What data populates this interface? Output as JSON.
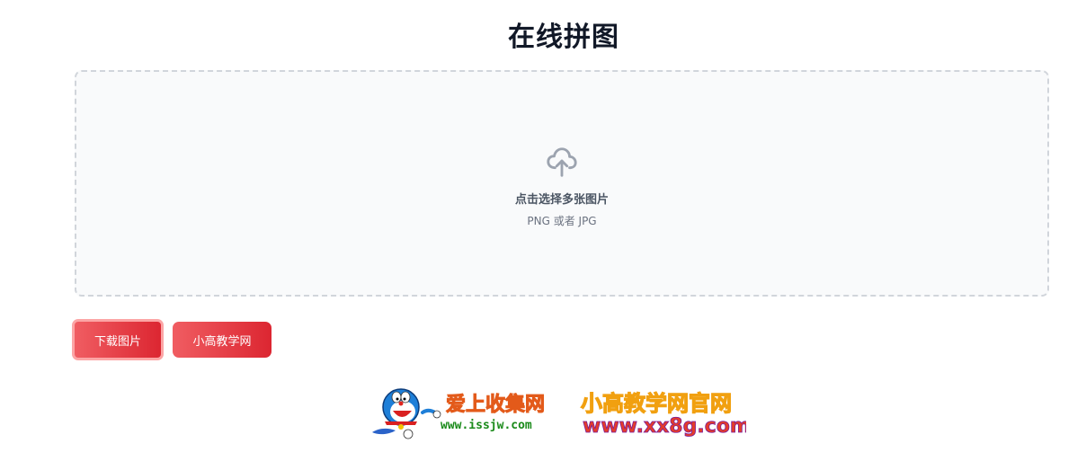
{
  "page": {
    "title": "在线拼图"
  },
  "dropzone": {
    "main_text": "点击选择多张图片",
    "sub_text": "PNG 或者 JPG",
    "icon": "cloud-upload-icon"
  },
  "buttons": {
    "download_label": "下载图片",
    "site_label": "小高教学网"
  },
  "footer": {
    "logo1_title": "爱上收集网",
    "logo1_url": "www.issjw.com",
    "logo2_title": "小高教学网官网",
    "logo2_url": "www.xx8g.com"
  },
  "colors": {
    "accent_start": "#f05d62",
    "accent_end": "#dc2631",
    "dropzone_bg": "#f9fafb",
    "dropzone_border": "#d1d5db"
  }
}
